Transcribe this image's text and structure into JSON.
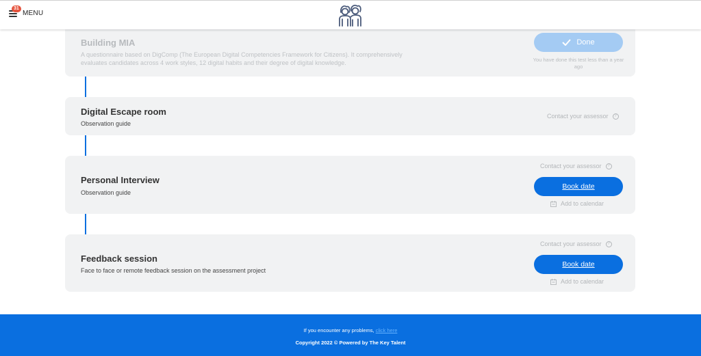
{
  "header": {
    "menu_label": "MENU",
    "notification_count": "31"
  },
  "cards": [
    {
      "title": "Building MIA",
      "description": "A questionnaire based on DigComp (The European Digital Competencies Framework for Citizens). It comprehensively evaluates candidates across 4 work styles, 12 digital habits and their degree of digital knowledge.",
      "done_label": "Done",
      "done_note": "You have done this test less than a year ago"
    },
    {
      "title": "Digital Escape room",
      "description": "Observation guide",
      "contact_label": "Contact your assessor"
    },
    {
      "title": "Personal Interview",
      "description": "Observation guide",
      "contact_label": "Contact your assessor",
      "book_label": "Book date",
      "calendar_label": "Add to calendar"
    },
    {
      "title": "Feedback session",
      "description": "Face to face or remote feedback session on the assessment project",
      "contact_label": "Contact your assessor",
      "book_label": "Book date",
      "calendar_label": "Add to calendar"
    }
  ],
  "footer": {
    "problems_text": "If you encounter any problems,",
    "link_text": "click here",
    "copyright": "Copyright 2022 © Powered by The Key Talent"
  },
  "colors": {
    "primary": "#0a6fe0",
    "done_button": "#a4cbf3",
    "card_bg": "#f1f2f3",
    "badge": "#e5533d"
  }
}
